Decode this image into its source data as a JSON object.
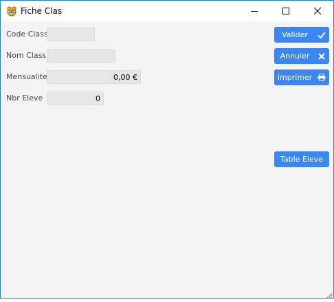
{
  "window": {
    "title": "Fiche Clas"
  },
  "form": {
    "code_class": {
      "label": "Code Class",
      "value": ""
    },
    "nom_class": {
      "label": "Nom Class",
      "value": ""
    },
    "mensualite": {
      "label": "Mensualite",
      "value": "0,00 €"
    },
    "nbr_eleve": {
      "label": "Nbr Eleve",
      "value": "0"
    }
  },
  "buttons": {
    "valider": "Valider",
    "annuler": "Annuler",
    "imprimer": "Imprimer",
    "table_eleve": "Table Eleve"
  },
  "colors": {
    "accent": "#3b86f0",
    "window_border": "#1883d7",
    "form_background": "#f4f4f4",
    "field_background": "#e6e6e6"
  },
  "icons": {
    "app": "app-logo-icon",
    "minimize": "minimize-icon",
    "maximize": "maximize-icon",
    "close": "close-icon",
    "valider": "checkmark-icon",
    "annuler": "x-icon",
    "imprimer": "printer-icon"
  }
}
